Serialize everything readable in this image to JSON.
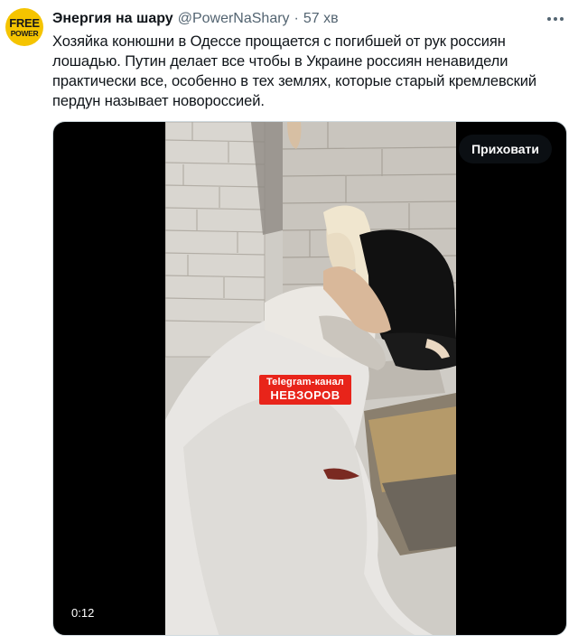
{
  "author": {
    "display_name": "Энергия на шару",
    "handle": "@PowerNaShary",
    "separator": "·",
    "time": "57 хв",
    "avatar_text_top": "FREE",
    "avatar_text_bottom": "POWER"
  },
  "tweet": {
    "text": "Хозяйка конюшни в Одессе прощается с погибшей от рук россиян лошадью. Путин делает все чтобы в Украине россиян ненавидели практически все, особенно в тех землях, которые старый кремлевский пердун называет новороссией."
  },
  "media": {
    "hide_label": "Приховати",
    "duration": "0:12",
    "watermark_line1": "Telegram-канал",
    "watermark_line2": "НЕВЗОРОВ"
  },
  "icons": {
    "more": "more-horizontal-icon"
  },
  "colors": {
    "text_primary": "#0f1419",
    "text_secondary": "#536471",
    "avatar_bg": "#f5c400",
    "watermark_bg": "#e8241a"
  }
}
